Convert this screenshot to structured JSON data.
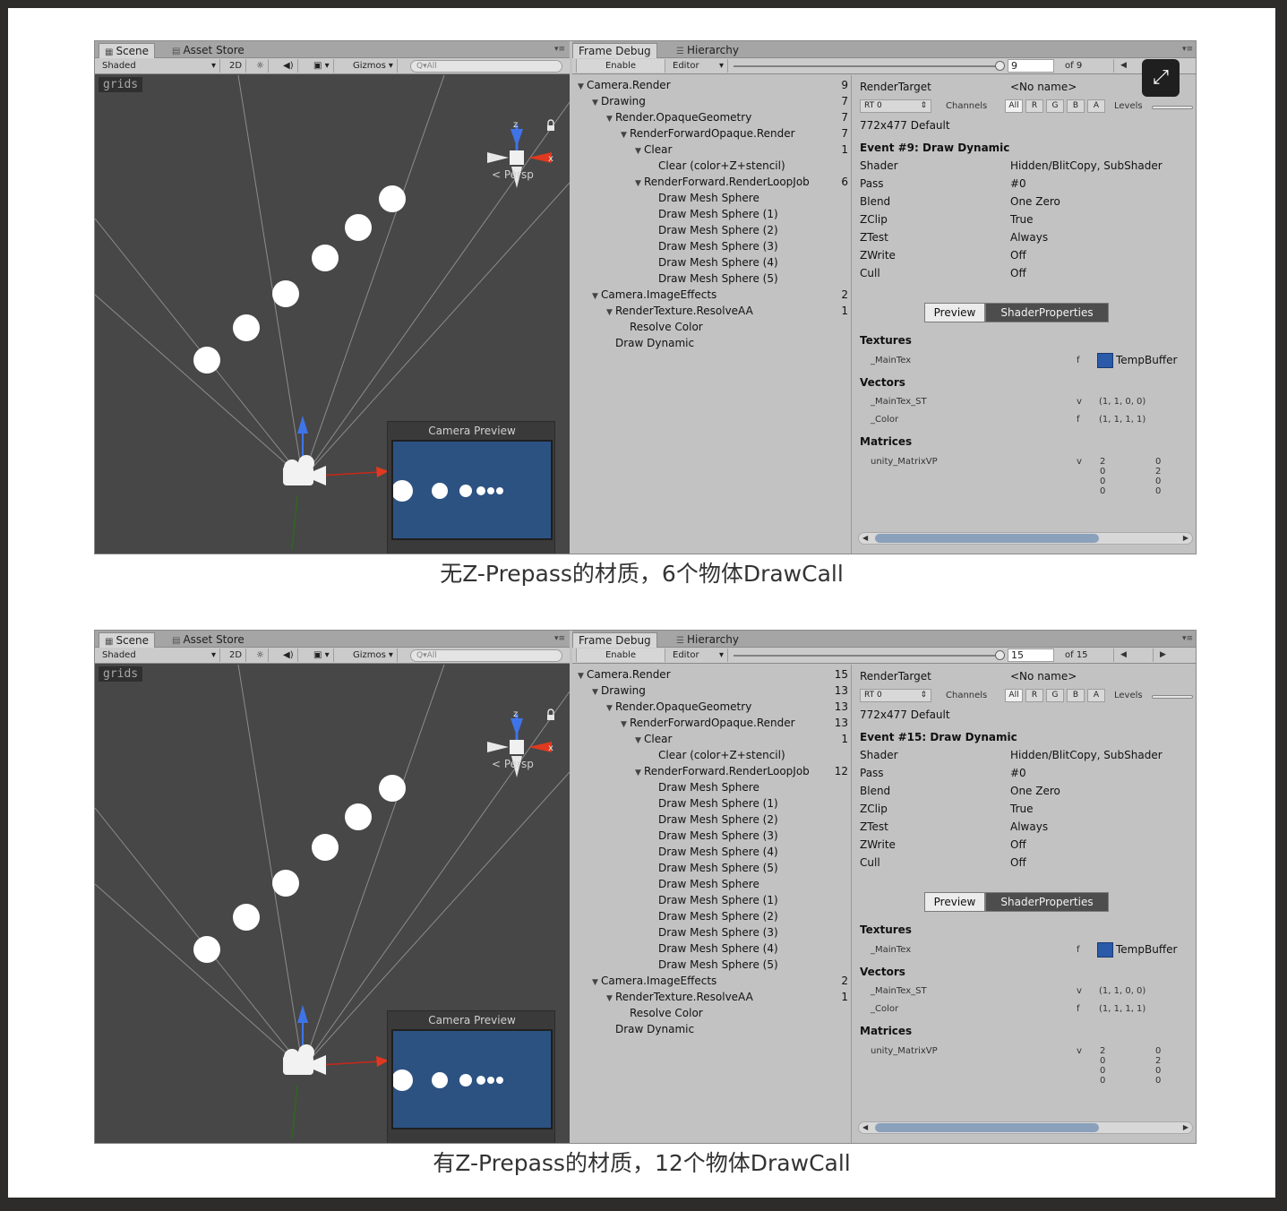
{
  "panels": [
    {
      "caption": "无Z-Prepass的材质，6个物体DrawCall",
      "scene": {
        "tab_scene": "Scene",
        "tab_asset_store": "Asset Store",
        "shading_mode": "Shaded",
        "btn_2d": "2D",
        "gizmos": "Gizmos",
        "search_placeholder": "Q▾All",
        "grids_label": "grids",
        "gizmo_axis_z": "z",
        "gizmo_axis_x": "x",
        "persp_label": "< Persp",
        "camera_preview_title": "Camera Preview"
      },
      "frame_debug": {
        "tab_frame_debug": "Frame Debug",
        "tab_hierarchy": "Hierarchy",
        "enable_label": "Enable",
        "editor_label": "Editor",
        "event_index": "9",
        "event_total_label": "of 9",
        "event_position": 1.0,
        "tree": [
          {
            "label": "Camera.Render",
            "count": "9",
            "depth": 0,
            "expandable": true
          },
          {
            "label": "Drawing",
            "count": "7",
            "depth": 1,
            "expandable": true
          },
          {
            "label": "Render.OpaqueGeometry",
            "count": "7",
            "depth": 2,
            "expandable": true
          },
          {
            "label": "RenderForwardOpaque.Render",
            "count": "7",
            "depth": 3,
            "expandable": true
          },
          {
            "label": "Clear",
            "count": "1",
            "depth": 4,
            "expandable": true
          },
          {
            "label": "Clear (color+Z+stencil)",
            "count": "",
            "depth": 5,
            "expandable": false
          },
          {
            "label": "RenderForward.RenderLoopJob",
            "count": "6",
            "depth": 4,
            "expandable": true
          },
          {
            "label": "Draw Mesh Sphere",
            "count": "",
            "depth": 5,
            "expandable": false
          },
          {
            "label": "Draw Mesh Sphere (1)",
            "count": "",
            "depth": 5,
            "expandable": false
          },
          {
            "label": "Draw Mesh Sphere (2)",
            "count": "",
            "depth": 5,
            "expandable": false
          },
          {
            "label": "Draw Mesh Sphere (3)",
            "count": "",
            "depth": 5,
            "expandable": false
          },
          {
            "label": "Draw Mesh Sphere (4)",
            "count": "",
            "depth": 5,
            "expandable": false
          },
          {
            "label": "Draw Mesh Sphere (5)",
            "count": "",
            "depth": 5,
            "expandable": false
          },
          {
            "label": "Camera.ImageEffects",
            "count": "2",
            "depth": 1,
            "expandable": true
          },
          {
            "label": "RenderTexture.ResolveAA",
            "count": "1",
            "depth": 2,
            "expandable": true
          },
          {
            "label": "Resolve Color",
            "count": "",
            "depth": 3,
            "expandable": false
          },
          {
            "label": "Draw Dynamic",
            "count": "",
            "depth": 2,
            "expandable": false
          }
        ],
        "details": {
          "render_target_label": "RenderTarget",
          "render_target_value": "<No name>",
          "rt_select": "RT 0",
          "channels_label": "Channels",
          "channels": [
            "All",
            "R",
            "G",
            "B",
            "A"
          ],
          "levels_label": "Levels",
          "resolution": "772x477 Default",
          "event_title": "Event #9: Draw Dynamic",
          "props": [
            {
              "key": "Shader",
              "value": "Hidden/BlitCopy, SubShader"
            },
            {
              "key": "Pass",
              "value": "#0"
            },
            {
              "key": "Blend",
              "value": "One Zero"
            },
            {
              "key": "ZClip",
              "value": "True"
            },
            {
              "key": "ZTest",
              "value": "Always"
            },
            {
              "key": "ZWrite",
              "value": "Off"
            },
            {
              "key": "Cull",
              "value": "Off"
            }
          ],
          "tab_preview": "Preview",
          "tab_shader_properties": "ShaderProperties",
          "textures_heading": "Textures",
          "texture_name": "_MainTex",
          "texture_type": "f",
          "texture_value": "TempBuffer",
          "vectors_heading": "Vectors",
          "vectors": [
            {
              "name": "_MainTex_ST",
              "type": "v",
              "value": "(1, 1, 0, 0)"
            },
            {
              "name": "_Color",
              "type": "f",
              "value": "(1, 1, 1, 1)"
            }
          ],
          "matrices_heading": "Matrices",
          "matrix_name": "unity_MatrixVP",
          "matrix_type": "v",
          "matrix_col1": [
            "2",
            "0",
            "0",
            "0"
          ],
          "matrix_col2": [
            "0",
            "2",
            "0",
            "0"
          ]
        }
      }
    },
    {
      "caption": "有Z-Prepass的材质，12个物体DrawCall",
      "scene": {
        "tab_scene": "Scene",
        "tab_asset_store": "Asset Store",
        "shading_mode": "Shaded",
        "btn_2d": "2D",
        "gizmos": "Gizmos",
        "search_placeholder": "Q▾All",
        "grids_label": "grids",
        "gizmo_axis_z": "z",
        "gizmo_axis_x": "x",
        "persp_label": "< Persp",
        "camera_preview_title": "Camera Preview"
      },
      "frame_debug": {
        "tab_frame_debug": "Frame Debug",
        "tab_hierarchy": "Hierarchy",
        "enable_label": "Enable",
        "editor_label": "Editor",
        "event_index": "15",
        "event_total_label": "of 15",
        "event_position": 1.0,
        "tree": [
          {
            "label": "Camera.Render",
            "count": "15",
            "depth": 0,
            "expandable": true
          },
          {
            "label": "Drawing",
            "count": "13",
            "depth": 1,
            "expandable": true
          },
          {
            "label": "Render.OpaqueGeometry",
            "count": "13",
            "depth": 2,
            "expandable": true
          },
          {
            "label": "RenderForwardOpaque.Render",
            "count": "13",
            "depth": 3,
            "expandable": true
          },
          {
            "label": "Clear",
            "count": "1",
            "depth": 4,
            "expandable": true
          },
          {
            "label": "Clear (color+Z+stencil)",
            "count": "",
            "depth": 5,
            "expandable": false
          },
          {
            "label": "RenderForward.RenderLoopJob",
            "count": "12",
            "depth": 4,
            "expandable": true
          },
          {
            "label": "Draw Mesh Sphere",
            "count": "",
            "depth": 5,
            "expandable": false
          },
          {
            "label": "Draw Mesh Sphere (1)",
            "count": "",
            "depth": 5,
            "expandable": false
          },
          {
            "label": "Draw Mesh Sphere (2)",
            "count": "",
            "depth": 5,
            "expandable": false
          },
          {
            "label": "Draw Mesh Sphere (3)",
            "count": "",
            "depth": 5,
            "expandable": false
          },
          {
            "label": "Draw Mesh Sphere (4)",
            "count": "",
            "depth": 5,
            "expandable": false
          },
          {
            "label": "Draw Mesh Sphere (5)",
            "count": "",
            "depth": 5,
            "expandable": false
          },
          {
            "label": "Draw Mesh Sphere",
            "count": "",
            "depth": 5,
            "expandable": false
          },
          {
            "label": "Draw Mesh Sphere (1)",
            "count": "",
            "depth": 5,
            "expandable": false
          },
          {
            "label": "Draw Mesh Sphere (2)",
            "count": "",
            "depth": 5,
            "expandable": false
          },
          {
            "label": "Draw Mesh Sphere (3)",
            "count": "",
            "depth": 5,
            "expandable": false
          },
          {
            "label": "Draw Mesh Sphere (4)",
            "count": "",
            "depth": 5,
            "expandable": false
          },
          {
            "label": "Draw Mesh Sphere (5)",
            "count": "",
            "depth": 5,
            "expandable": false
          },
          {
            "label": "Camera.ImageEffects",
            "count": "2",
            "depth": 1,
            "expandable": true
          },
          {
            "label": "RenderTexture.ResolveAA",
            "count": "1",
            "depth": 2,
            "expandable": true
          },
          {
            "label": "Resolve Color",
            "count": "",
            "depth": 3,
            "expandable": false
          },
          {
            "label": "Draw Dynamic",
            "count": "",
            "depth": 2,
            "expandable": false
          }
        ],
        "details": {
          "render_target_label": "RenderTarget",
          "render_target_value": "<No name>",
          "rt_select": "RT 0",
          "channels_label": "Channels",
          "channels": [
            "All",
            "R",
            "G",
            "B",
            "A"
          ],
          "levels_label": "Levels",
          "resolution": "772x477 Default",
          "event_title": "Event #15: Draw Dynamic",
          "props": [
            {
              "key": "Shader",
              "value": "Hidden/BlitCopy, SubShader"
            },
            {
              "key": "Pass",
              "value": "#0"
            },
            {
              "key": "Blend",
              "value": "One Zero"
            },
            {
              "key": "ZClip",
              "value": "True"
            },
            {
              "key": "ZTest",
              "value": "Always"
            },
            {
              "key": "ZWrite",
              "value": "Off"
            },
            {
              "key": "Cull",
              "value": "Off"
            }
          ],
          "tab_preview": "Preview",
          "tab_shader_properties": "ShaderProperties",
          "textures_heading": "Textures",
          "texture_name": "_MainTex",
          "texture_type": "f",
          "texture_value": "TempBuffer",
          "vectors_heading": "Vectors",
          "vectors": [
            {
              "name": "_MainTex_ST",
              "type": "v",
              "value": "(1, 1, 0, 0)"
            },
            {
              "name": "_Color",
              "type": "f",
              "value": "(1, 1, 1, 1)"
            }
          ],
          "matrices_heading": "Matrices",
          "matrix_name": "unity_MatrixVP",
          "matrix_type": "v",
          "matrix_col1": [
            "2",
            "0",
            "0",
            "0"
          ],
          "matrix_col2": [
            "0",
            "2",
            "0",
            "0"
          ]
        }
      }
    }
  ],
  "colors": {
    "viewport_bg": "#474747",
    "camera_view_bg": "#2c5282",
    "gizmo_z": "#3f74e8",
    "gizmo_x": "#e0391f",
    "selected_chip": "#2a5aa8"
  }
}
